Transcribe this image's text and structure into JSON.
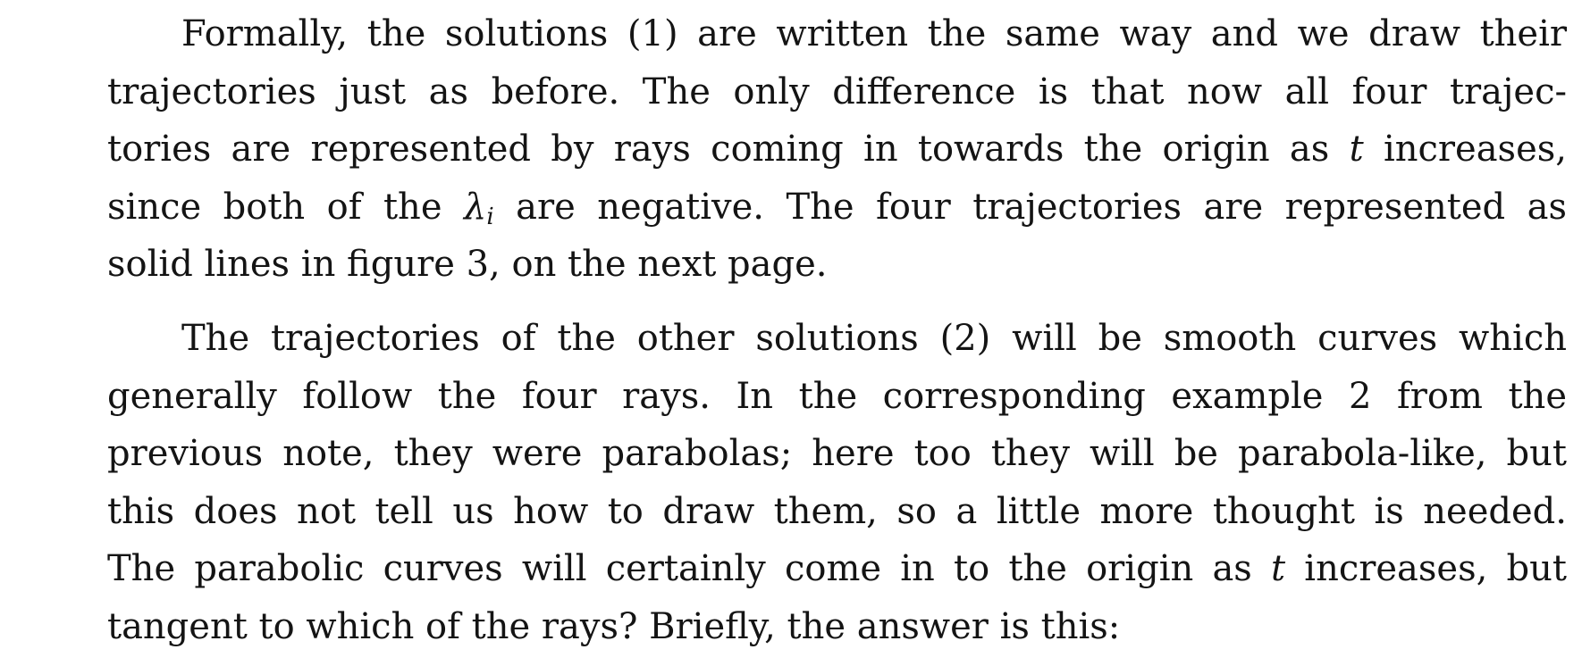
{
  "paragraphs": [
    {
      "lines": [
        "Formally, the solutions (1) are written the same way and we draw their",
        "trajectories just as before.  The only difference is that now all four trajec-",
        [
          "tories are represented by rays coming in towards the origin as ",
          {
            "math": "t"
          },
          " increases,"
        ],
        [
          "since both of the ",
          {
            "math": "λ",
            "sub": "i"
          },
          " are negative.  The four trajectories are represented as"
        ],
        "solid lines in figure 3, on the next page."
      ]
    },
    {
      "lines": [
        "The trajectories of the other solutions (2) will be smooth curves which",
        "generally follow the four rays.  In the corresponding example 2 from the",
        "previous note, they were parabolas; here too they will be parabola-like, but",
        "this does not tell us how to draw them, so a little more thought is needed.",
        [
          "The parabolic curves will certainly come in to the origin as ",
          {
            "math": "t"
          },
          " increases, but"
        ],
        "tangent to which of the rays? Briefly, the answer is this:"
      ]
    }
  ]
}
